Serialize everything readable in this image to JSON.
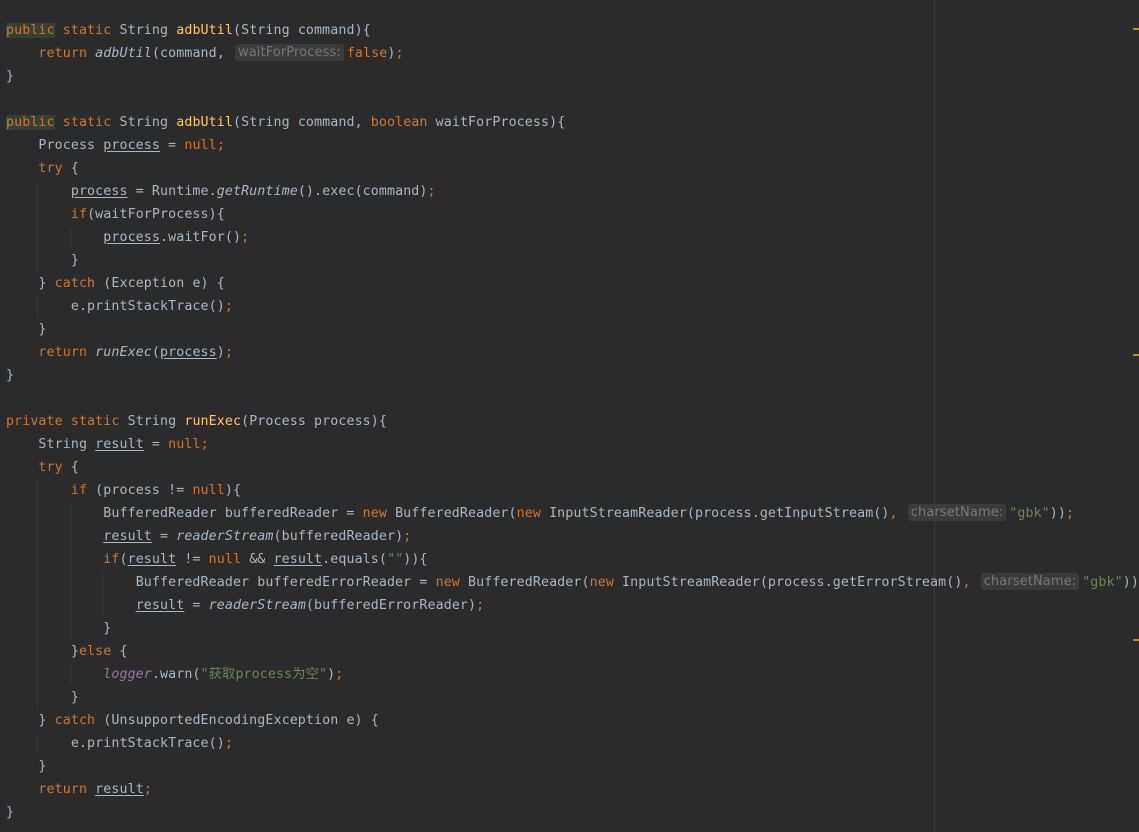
{
  "editor": {
    "language": "java",
    "indent_unit": "    ",
    "colors": {
      "background": "#2b2b2b",
      "keyword": "#cc7832",
      "method_declaration": "#ffc66d",
      "string": "#6a8759",
      "field": "#9876aa",
      "text": "#a9b7c6",
      "hint": "#787878",
      "match_highlight": "#344134",
      "stripe_marker": "#be9117"
    },
    "lines": [
      {
        "indent": 0,
        "tokens": [
          {
            "t": "public",
            "c": "kw hl"
          },
          {
            "t": " static ",
            "c": "kw"
          },
          {
            "t": "String "
          },
          {
            "t": "adbUtil",
            "c": "fn"
          },
          {
            "t": "(String command){"
          }
        ]
      },
      {
        "indent": 1,
        "tokens": [
          {
            "t": "return ",
            "c": "kw"
          },
          {
            "t": "adbUtil",
            "c": "it"
          },
          {
            "t": "(command, "
          },
          {
            "t": "waitForProcess:",
            "c": "hint"
          },
          {
            "t": "false",
            "c": "kw"
          },
          {
            "t": ")"
          },
          {
            "t": ";",
            "c": "kw"
          }
        ]
      },
      {
        "indent": 0,
        "tokens": [
          {
            "t": "}"
          }
        ]
      },
      {
        "indent": 0,
        "tokens": []
      },
      {
        "indent": 0,
        "tokens": [
          {
            "t": "public",
            "c": "kw hl"
          },
          {
            "t": " static ",
            "c": "kw"
          },
          {
            "t": "String "
          },
          {
            "t": "adbUtil",
            "c": "fn"
          },
          {
            "t": "(String command, "
          },
          {
            "t": "boolean ",
            "c": "kw"
          },
          {
            "t": "waitForProcess){"
          }
        ]
      },
      {
        "indent": 1,
        "tokens": [
          {
            "t": "Process "
          },
          {
            "t": "process",
            "c": "ul"
          },
          {
            "t": " = "
          },
          {
            "t": "null",
            "c": "kw"
          },
          {
            "t": ";",
            "c": "kw"
          }
        ]
      },
      {
        "indent": 1,
        "tokens": [
          {
            "t": "try ",
            "c": "kw"
          },
          {
            "t": "{"
          }
        ]
      },
      {
        "indent": 2,
        "tokens": [
          {
            "t": "process",
            "c": "ul"
          },
          {
            "t": " = Runtime."
          },
          {
            "t": "getRuntime",
            "c": "it"
          },
          {
            "t": "().exec(command)"
          },
          {
            "t": ";",
            "c": "kw"
          }
        ]
      },
      {
        "indent": 2,
        "tokens": [
          {
            "t": "if",
            "c": "kw"
          },
          {
            "t": "(waitForProcess){"
          }
        ]
      },
      {
        "indent": 3,
        "tokens": [
          {
            "t": "process",
            "c": "ul"
          },
          {
            "t": ".waitFor()"
          },
          {
            "t": ";",
            "c": "kw"
          }
        ]
      },
      {
        "indent": 2,
        "tokens": [
          {
            "t": "}"
          }
        ]
      },
      {
        "indent": 1,
        "tokens": [
          {
            "t": "} "
          },
          {
            "t": "catch ",
            "c": "kw"
          },
          {
            "t": "(Exception e) {"
          }
        ]
      },
      {
        "indent": 2,
        "tokens": [
          {
            "t": "e.printStackTrace()"
          },
          {
            "t": ";",
            "c": "kw"
          }
        ]
      },
      {
        "indent": 1,
        "tokens": [
          {
            "t": "}"
          }
        ]
      },
      {
        "indent": 1,
        "tokens": [
          {
            "t": "return ",
            "c": "kw"
          },
          {
            "t": "runExec",
            "c": "it"
          },
          {
            "t": "("
          },
          {
            "t": "process",
            "c": "ul"
          },
          {
            "t": ")"
          },
          {
            "t": ";",
            "c": "kw"
          }
        ]
      },
      {
        "indent": 0,
        "tokens": [
          {
            "t": "}"
          }
        ]
      },
      {
        "indent": 0,
        "tokens": []
      },
      {
        "indent": 0,
        "tokens": [
          {
            "t": "private static ",
            "c": "kw"
          },
          {
            "t": "String "
          },
          {
            "t": "runExec",
            "c": "fn"
          },
          {
            "t": "(Process process){"
          }
        ]
      },
      {
        "indent": 1,
        "tokens": [
          {
            "t": "String "
          },
          {
            "t": "result",
            "c": "ul"
          },
          {
            "t": " = "
          },
          {
            "t": "null",
            "c": "kw"
          },
          {
            "t": ";",
            "c": "kw"
          }
        ]
      },
      {
        "indent": 1,
        "tokens": [
          {
            "t": "try ",
            "c": "kw"
          },
          {
            "t": "{"
          }
        ]
      },
      {
        "indent": 2,
        "tokens": [
          {
            "t": "if ",
            "c": "kw"
          },
          {
            "t": "(process != "
          },
          {
            "t": "null",
            "c": "kw"
          },
          {
            "t": "){"
          }
        ]
      },
      {
        "indent": 3,
        "tokens": [
          {
            "t": "BufferedReader bufferedReader = "
          },
          {
            "t": "new ",
            "c": "kw"
          },
          {
            "t": "BufferedReader("
          },
          {
            "t": "new ",
            "c": "kw"
          },
          {
            "t": "InputStreamReader(process.getInputStream()"
          },
          {
            "t": ", ",
            "c": "kw"
          },
          {
            "t": "charsetName:",
            "c": "hint"
          },
          {
            "t": "\"gbk\"",
            "c": "str"
          },
          {
            "t": "))"
          },
          {
            "t": ";",
            "c": "kw"
          }
        ]
      },
      {
        "indent": 3,
        "tokens": [
          {
            "t": "result",
            "c": "ul"
          },
          {
            "t": " = "
          },
          {
            "t": "readerStream",
            "c": "it"
          },
          {
            "t": "(bufferedReader)"
          },
          {
            "t": ";",
            "c": "kw"
          }
        ]
      },
      {
        "indent": 3,
        "tokens": [
          {
            "t": "if",
            "c": "kw"
          },
          {
            "t": "("
          },
          {
            "t": "result",
            "c": "ul"
          },
          {
            "t": " != "
          },
          {
            "t": "null ",
            "c": "kw"
          },
          {
            "t": "&& "
          },
          {
            "t": "result",
            "c": "ul"
          },
          {
            "t": ".equals("
          },
          {
            "t": "\"\"",
            "c": "str"
          },
          {
            "t": ")){"
          }
        ]
      },
      {
        "indent": 4,
        "tokens": [
          {
            "t": "BufferedReader bufferedErrorReader = "
          },
          {
            "t": "new ",
            "c": "kw"
          },
          {
            "t": "BufferedReader("
          },
          {
            "t": "new ",
            "c": "kw"
          },
          {
            "t": "InputStreamReader(process.getErrorStream()"
          },
          {
            "t": ", ",
            "c": "kw"
          },
          {
            "t": "charsetName:",
            "c": "hint"
          },
          {
            "t": "\"gbk\"",
            "c": "str"
          },
          {
            "t": "))"
          },
          {
            "t": ";",
            "c": "kw"
          }
        ]
      },
      {
        "indent": 4,
        "tokens": [
          {
            "t": "result",
            "c": "ul"
          },
          {
            "t": " = "
          },
          {
            "t": "readerStream",
            "c": "it"
          },
          {
            "t": "(bufferedErrorReader)"
          },
          {
            "t": ";",
            "c": "kw"
          }
        ]
      },
      {
        "indent": 3,
        "tokens": [
          {
            "t": "}"
          }
        ]
      },
      {
        "indent": 2,
        "tokens": [
          {
            "t": "}"
          },
          {
            "t": "else ",
            "c": "kw"
          },
          {
            "t": "{"
          }
        ]
      },
      {
        "indent": 3,
        "tokens": [
          {
            "t": "logger",
            "c": "fieldv"
          },
          {
            "t": ".warn("
          },
          {
            "t": "\"获取process为空\"",
            "c": "str"
          },
          {
            "t": ")"
          },
          {
            "t": ";",
            "c": "kw"
          }
        ]
      },
      {
        "indent": 2,
        "tokens": [
          {
            "t": "}"
          }
        ]
      },
      {
        "indent": 1,
        "tokens": [
          {
            "t": "} "
          },
          {
            "t": "catch ",
            "c": "kw"
          },
          {
            "t": "(UnsupportedEncodingException e) {"
          }
        ]
      },
      {
        "indent": 2,
        "tokens": [
          {
            "t": "e.printStackTrace()"
          },
          {
            "t": ";",
            "c": "kw"
          }
        ]
      },
      {
        "indent": 1,
        "tokens": [
          {
            "t": "}"
          }
        ]
      },
      {
        "indent": 1,
        "tokens": [
          {
            "t": "return ",
            "c": "kw"
          },
          {
            "t": "result",
            "c": "ul"
          },
          {
            "t": ";",
            "c": "kw"
          }
        ]
      },
      {
        "indent": 0,
        "tokens": [
          {
            "t": "}"
          }
        ]
      }
    ]
  }
}
